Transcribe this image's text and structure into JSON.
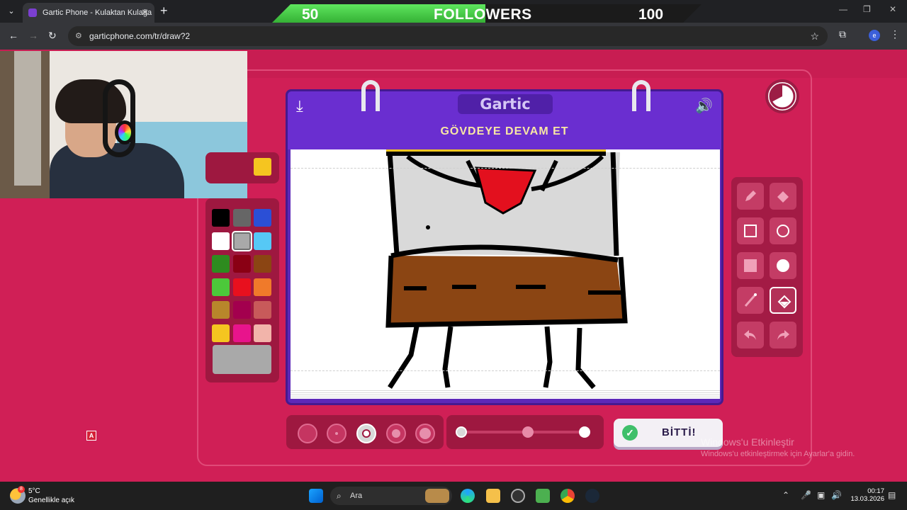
{
  "browser": {
    "tab_title": "Gartic Phone - Kulaktan Kulağa",
    "url": "garticphone.com/tr/draw?2",
    "profile_initial": "e"
  },
  "overlay": {
    "followers_current": "50",
    "followers_label": "FOLLOWERS",
    "followers_goal": "100",
    "progress_fraction": 0.5
  },
  "game": {
    "logo": "Gartic",
    "task": "GÖVDEYE DEVAM ET",
    "done_button": "BİTTİ!",
    "palette": [
      "#000000",
      "#666666",
      "#2b4fd6",
      "#ffffff",
      "#a9a9a9",
      "#56c8f5",
      "#2e8b1f",
      "#8a0014",
      "#8b4513",
      "#4cc83a",
      "#e8101e",
      "#f07a2a",
      "#b8862b",
      "#a3004e",
      "#c85a5a",
      "#f5c520",
      "#e8148c",
      "#f2b4aa"
    ],
    "selected_color": "#a9a9a9",
    "top_swatch": "#f5c520",
    "brush_sizes": 5,
    "selected_size_index": 2,
    "selected_tool": "fill"
  },
  "watermark": {
    "line1": "Windows'u Etkinleştir",
    "line2": "Windows'u etkinleştirmek için Ayarlar'a gidin."
  },
  "taskbar": {
    "temp": "5°C",
    "weather": "Genellikle açık",
    "search_placeholder": "Ara",
    "time": "00:17",
    "date": "13.03.2026",
    "weather_badge": "8"
  },
  "stream_badge": "A"
}
